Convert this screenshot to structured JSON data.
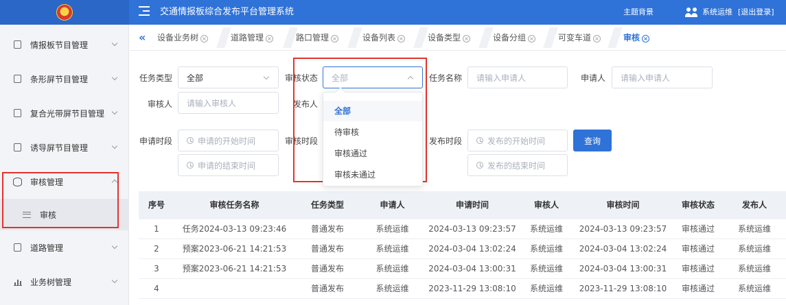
{
  "header": {
    "title": "交通情报板综合发布平台管理系统",
    "theme_label": "主题背景",
    "user_name": "系统运维",
    "logout_label": "[退出登录]"
  },
  "sidebar": {
    "items": [
      {
        "label": "情报板节目管理"
      },
      {
        "label": "条形屏节目管理"
      },
      {
        "label": "复合光带屏节目管理"
      },
      {
        "label": "诱导屏节目管理"
      },
      {
        "label": "审核管理",
        "expanded": true
      },
      {
        "label": "道路管理"
      },
      {
        "label": "业务树管理"
      }
    ],
    "sub_items": [
      {
        "label": "审核",
        "active": true
      }
    ]
  },
  "tabs": [
    {
      "label": "设备业务树"
    },
    {
      "label": "道路管理"
    },
    {
      "label": "路口管理"
    },
    {
      "label": "设备列表"
    },
    {
      "label": "设备类型"
    },
    {
      "label": "设备分组"
    },
    {
      "label": "可变车道"
    },
    {
      "label": "审核",
      "active": true
    }
  ],
  "filters": {
    "task_type": {
      "label": "任务类型",
      "value": "全部"
    },
    "audit_status": {
      "label": "审核状态",
      "placeholder": "全部"
    },
    "task_name": {
      "label": "任务名称",
      "placeholder": "请输入申请人"
    },
    "applicant": {
      "label": "申请人",
      "placeholder": "请输入申请人"
    },
    "auditor": {
      "label": "审核人",
      "placeholder": "请输入审核人"
    },
    "publisher": {
      "label": "发布人"
    },
    "apply_time": {
      "label": "申请时段",
      "start_placeholder": "申请的开始时间",
      "end_placeholder": "申请的结束时间"
    },
    "audit_time": {
      "label": "审核时段"
    },
    "publish_time": {
      "label": "发布时段",
      "start_placeholder": "发布的开始时间",
      "end_placeholder": "发布的结束时间"
    },
    "query_label": "查询"
  },
  "dropdown": {
    "options": [
      "全部",
      "待审核",
      "审核通过",
      "审核未通过"
    ],
    "selected_index": 0
  },
  "table": {
    "columns": [
      "序号",
      "审核任务名称",
      "任务类型",
      "申请人",
      "申请时间",
      "审核人",
      "审核时间",
      "审核状态",
      "发布人"
    ],
    "rows": [
      [
        "1",
        "任务2024-03-13 09:23:46",
        "普通发布",
        "系统运维",
        "2024-03-13 09:23:57",
        "系统运维",
        "2024-03-13 09:23:57",
        "审核通过",
        "系统运维"
      ],
      [
        "2",
        "预案2023-06-21 14:21:53",
        "普通发布",
        "系统运维",
        "2024-03-04 13:02:24",
        "系统运维",
        "2024-03-04 13:02:24",
        "审核通过",
        "系统运维"
      ],
      [
        "3",
        "预案2023-06-21 14:21:53",
        "普通发布",
        "系统运维",
        "2024-03-04 13:00:31",
        "系统运维",
        "2024-03-04 13:00:31",
        "审核通过",
        "系统运维"
      ],
      [
        "4",
        "",
        "普通发布",
        "系统运维",
        "2023-11-29 13:08:10",
        "系统运维",
        "2023-11-29 13:08:10",
        "审核通过",
        "系统运维"
      ]
    ]
  },
  "colors": {
    "primary": "#2f72d8",
    "highlight": "#e3322d"
  }
}
